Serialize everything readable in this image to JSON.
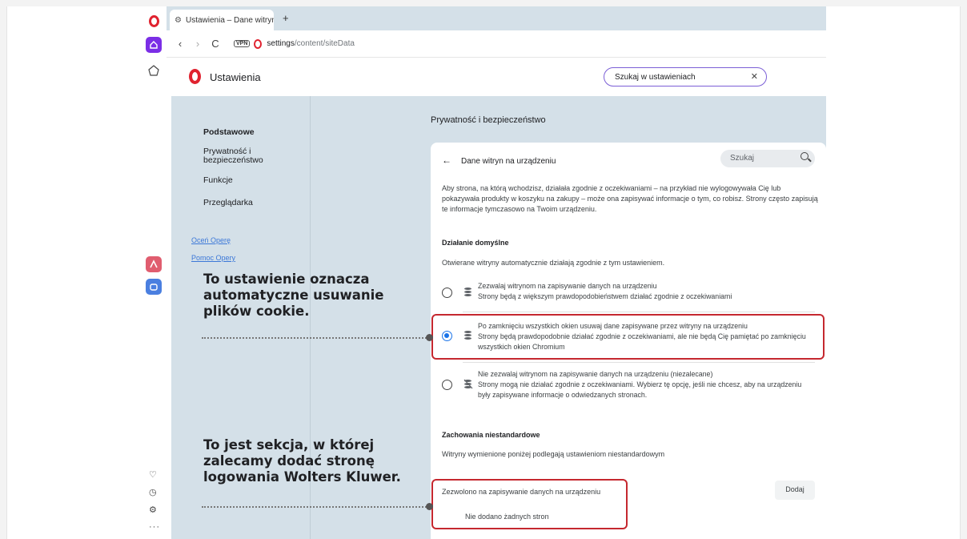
{
  "tab": {
    "title": "Ustawienia – Dane witryn"
  },
  "toolbar": {
    "vpn": "VPN",
    "url_host": "settings",
    "url_path": "/content/siteData"
  },
  "header": {
    "title": "Ustawienia",
    "search_value": "Szukaj w ustawieniach"
  },
  "nav": {
    "items": [
      "Podstawowe",
      "Prywatność i bezpieczeństwo",
      "Funkcje",
      "Przeglądarka"
    ],
    "links": [
      "Oceń Operę",
      "Pomoc Opery"
    ]
  },
  "section_title": "Prywatność i bezpieczeństwo",
  "card": {
    "title": "Dane witryn na urządzeniu",
    "search_placeholder": "Szukaj",
    "description": "Aby strona, na którą wchodzisz, działała zgodnie z oczekiwaniami – na przykład nie wylogowywała Cię lub pokazywała produkty w koszyku na zakupy – może ona zapisywać informacje o tym, co robisz. Strony często zapisują te informacje tymczasowo na Twoim urządzeniu.",
    "default_heading": "Działanie domyślne",
    "default_sub": "Otwierane witryny automatycznie działają zgodnie z tym ustawieniem.",
    "options": [
      {
        "title": "Zezwalaj witrynom na zapisywanie danych na urządzeniu",
        "desc": "Strony będą z większym prawdopodobieństwem działać zgodnie z oczekiwaniami",
        "selected": false
      },
      {
        "title": "Po zamknięciu wszystkich okien usuwaj dane zapisywane przez witryny na urządzeniu",
        "desc": "Strony będą prawdopodobnie działać zgodnie z oczekiwaniami, ale nie będą Cię pamiętać po zamknięciu wszystkich okien Chromium",
        "selected": true
      },
      {
        "title": "Nie zezwalaj witrynom na zapisywanie danych na urządzeniu (niezalecane)",
        "desc": "Strony mogą nie działać zgodnie z oczekiwaniami. Wybierz tę opcję, jeśli nie chcesz, aby na urządzeniu były zapisywane informacje o odwiedzanych stronach.",
        "selected": false
      }
    ],
    "custom_heading": "Zachowania niestandardowe",
    "custom_sub": "Witryny wymienione poniżej podlegają ustawieniom niestandardowym",
    "allow_label": "Zezwolono na zapisywanie danych na urządzeniu",
    "add_button": "Dodaj",
    "none_added": "Nie dodano żadnych stron"
  },
  "annotations": {
    "note1": "To ustawienie oznacza automatyczne usuwanie plików cookie.",
    "note2": "To jest sekcja, w której zalecamy dodać stronę logowania Wolters Kluwer."
  },
  "colors": {
    "opera_red": "#e0222f",
    "highlight": "#c5282f",
    "radio_blue": "#1a73e8",
    "page_bg": "#d4e0e8"
  }
}
